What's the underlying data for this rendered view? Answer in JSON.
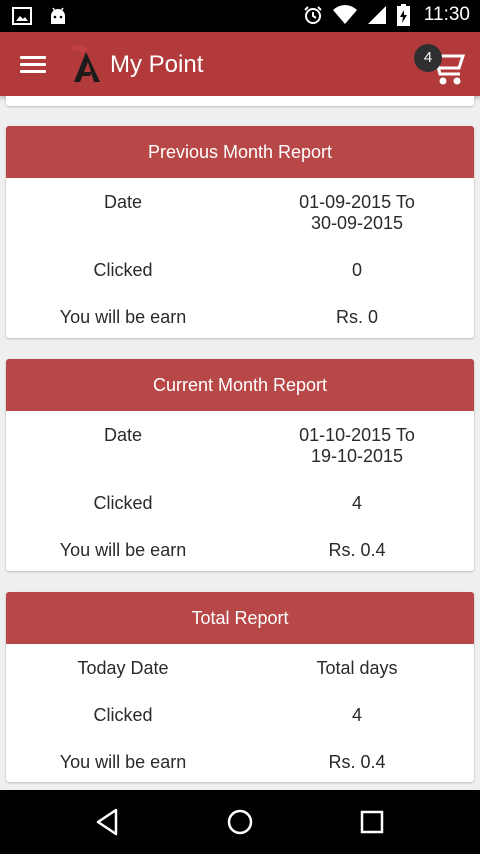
{
  "status_bar": {
    "time": "11:30",
    "icons": [
      "image-icon",
      "android-icon",
      "alarm-icon",
      "wifi-icon",
      "signal-icon",
      "battery-icon"
    ]
  },
  "app_bar": {
    "title": "My Point",
    "cart_count": "4",
    "accent_color": "#b23a3a"
  },
  "reports": [
    {
      "title": "Previous Month Report",
      "rows": [
        {
          "label": "Date",
          "value_line1": "01-09-2015 To",
          "value_line2": "30-09-2015"
        },
        {
          "label": "Clicked",
          "value_line1": "0"
        },
        {
          "label": "You will be earn",
          "value_line1": "Rs. 0"
        }
      ]
    },
    {
      "title": "Current Month Report",
      "rows": [
        {
          "label": "Date",
          "value_line1": "01-10-2015 To",
          "value_line2": "19-10-2015"
        },
        {
          "label": "Clicked",
          "value_line1": "4"
        },
        {
          "label": "You will be earn",
          "value_line1": "Rs. 0.4"
        }
      ]
    },
    {
      "title": "Total Report",
      "rows": [
        {
          "label": "Today Date",
          "value_line1": "Total days"
        },
        {
          "label": "Clicked",
          "value_line1": "4"
        },
        {
          "label": "You will be earn",
          "value_line1": "Rs. 0.4"
        }
      ]
    }
  ],
  "nav_bar": {
    "icons": [
      "back-icon",
      "home-icon",
      "recents-icon"
    ]
  }
}
